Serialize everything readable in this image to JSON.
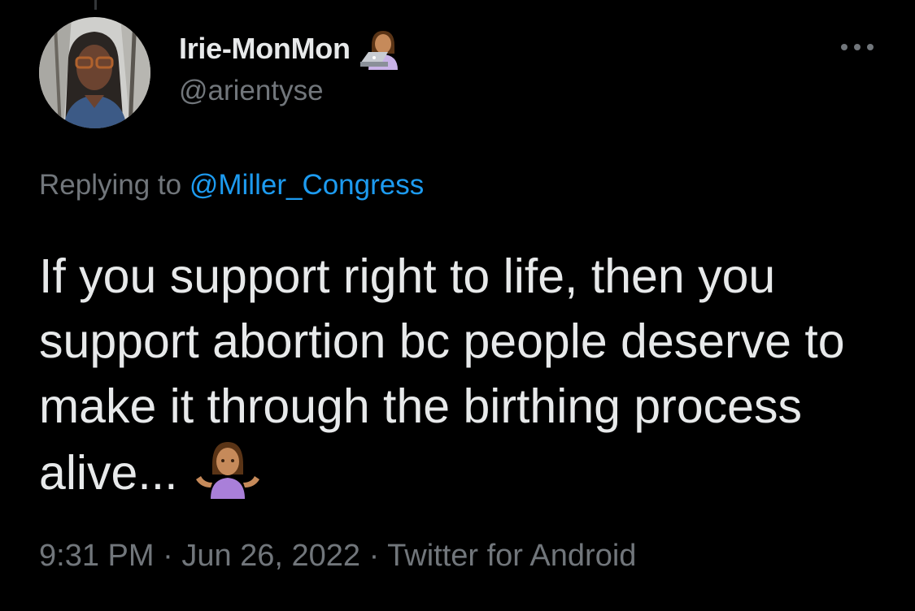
{
  "tweet": {
    "display_name": "Irie-MonMon",
    "handle": "@arientyse",
    "name_emoji": "woman-technologist-emoji",
    "more_icon": "ellipsis-icon",
    "replying_prefix": "Replying to",
    "replying_to": "@Miller_Congress",
    "text": "If you support right to life, then you support abortion bc people deserve to make it through the birthing process alive...",
    "text_emoji": "woman-shrugging-emoji",
    "time": "9:31 PM",
    "date": "Jun 26, 2022",
    "source": "Twitter for Android",
    "separator": "·"
  },
  "colors": {
    "background": "#000000",
    "primary_text": "#e7e9ea",
    "secondary_text": "#71767b",
    "accent": "#1d9bf0"
  }
}
